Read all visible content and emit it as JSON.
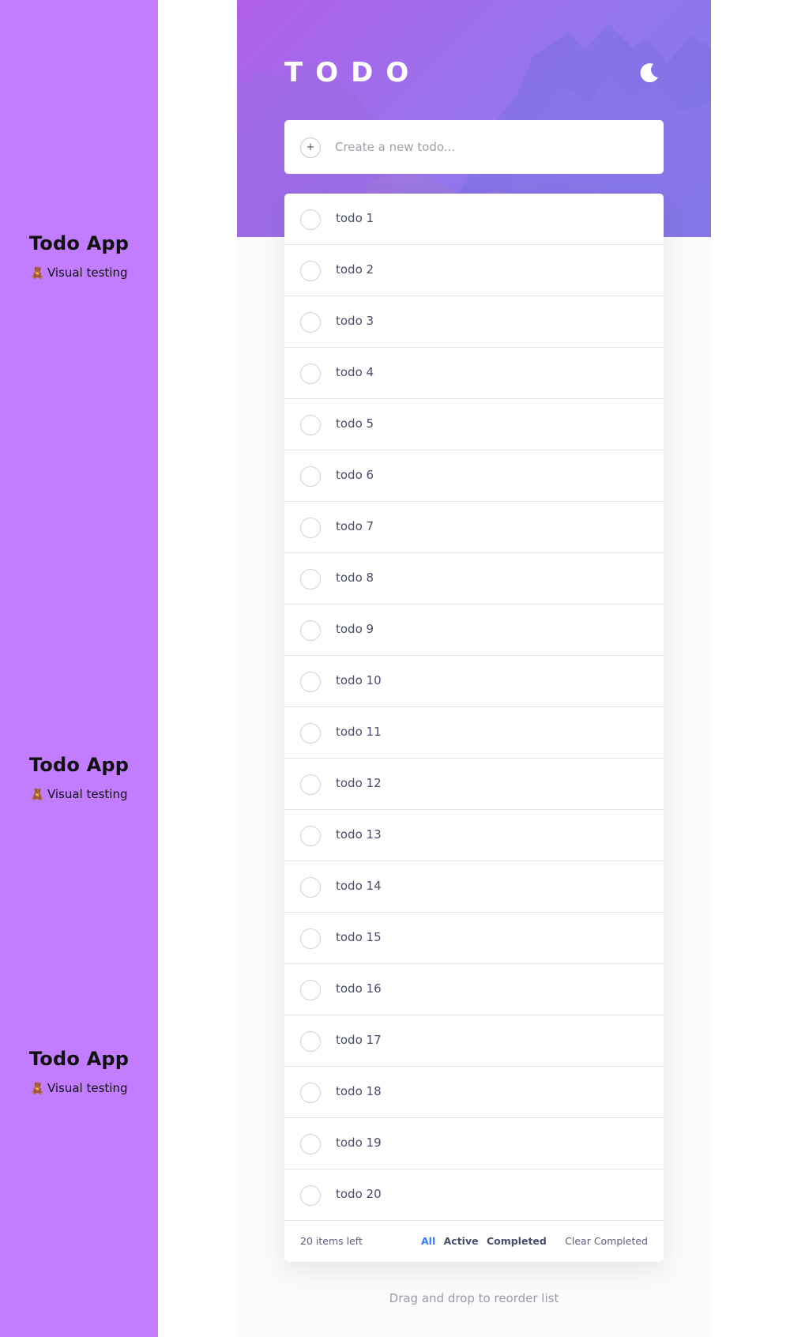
{
  "sidebar": {
    "badges": [
      {
        "title": "Todo App",
        "subtitle": "Visual testing",
        "emoji": "🧸"
      },
      {
        "title": "Todo App",
        "subtitle": "Visual testing",
        "emoji": "🧸"
      },
      {
        "title": "Todo App",
        "subtitle": "Visual testing",
        "emoji": "🧸"
      }
    ]
  },
  "header": {
    "title": "TODO",
    "theme_icon": "moon-icon"
  },
  "create": {
    "placeholder": "Create a new todo...",
    "icon": "plus-icon"
  },
  "todos": [
    {
      "label": "todo 1"
    },
    {
      "label": "todo 2"
    },
    {
      "label": "todo 3"
    },
    {
      "label": "todo 4"
    },
    {
      "label": "todo 5"
    },
    {
      "label": "todo 6"
    },
    {
      "label": "todo 7"
    },
    {
      "label": "todo 8"
    },
    {
      "label": "todo 9"
    },
    {
      "label": "todo 10"
    },
    {
      "label": "todo 11"
    },
    {
      "label": "todo 12"
    },
    {
      "label": "todo 13"
    },
    {
      "label": "todo 14"
    },
    {
      "label": "todo 15"
    },
    {
      "label": "todo 16"
    },
    {
      "label": "todo 17"
    },
    {
      "label": "todo 18"
    },
    {
      "label": "todo 19"
    },
    {
      "label": "todo 20"
    }
  ],
  "footer": {
    "items_left": "20 items left",
    "filters": {
      "all": "All",
      "active": "Active",
      "completed": "Completed"
    },
    "clear": "Clear Completed"
  },
  "hint": "Drag and drop to reorder list",
  "colors": {
    "sidebar": "#c27cfe",
    "accent": "#3a7bfd",
    "text": "#494c6b"
  }
}
